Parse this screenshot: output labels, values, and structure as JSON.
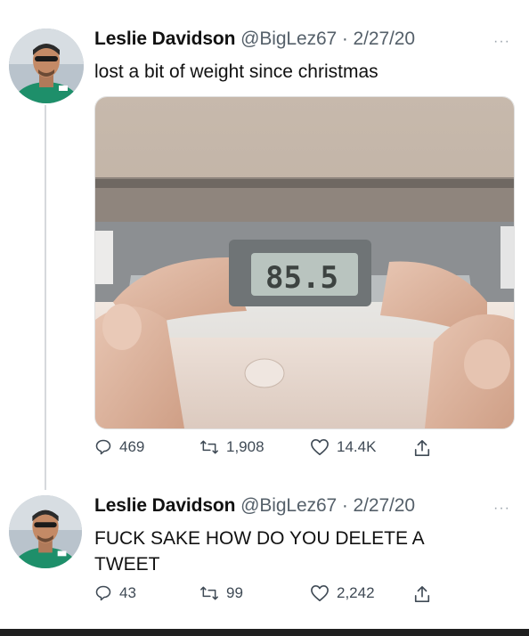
{
  "tweets": [
    {
      "name": "Leslie Davidson",
      "handle": "@BigLez67",
      "separator": "·",
      "date": "2/27/20",
      "more": "···",
      "text": "lost a bit of weight since christmas",
      "media": {
        "scale_reading": "85.5"
      },
      "replies": "469",
      "retweets": "1,908",
      "likes": "14.4K"
    },
    {
      "name": "Leslie Davidson",
      "handle": "@BigLez67",
      "separator": "·",
      "date": "2/27/20",
      "more": "···",
      "text": "FUCK SAKE HOW DO YOU DELETE A TWEET",
      "replies": "43",
      "retweets": "99",
      "likes": "2,242"
    }
  ],
  "icons": {
    "reply": "reply-icon",
    "retweet": "retweet-icon",
    "like": "heart-icon",
    "share": "share-icon",
    "more": "more-icon"
  },
  "colors": {
    "text": "#111111",
    "muted": "#55606a",
    "icon": "#3f4a55",
    "thread_line": "#d6d9dc"
  }
}
